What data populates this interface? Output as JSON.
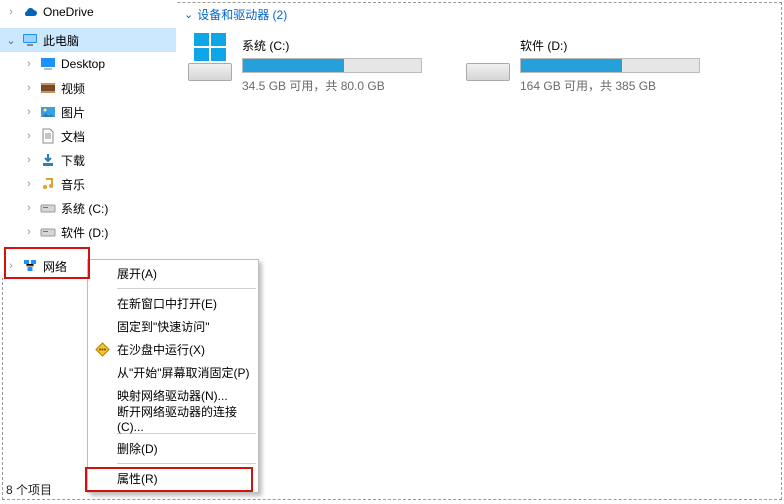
{
  "sidebar": {
    "onedrive_label": "OneDrive",
    "thispc_label": "此电脑",
    "items": [
      {
        "label": "Desktop"
      },
      {
        "label": "视频"
      },
      {
        "label": "图片"
      },
      {
        "label": "文档"
      },
      {
        "label": "下载"
      },
      {
        "label": "音乐"
      },
      {
        "label": "系统 (C:)"
      },
      {
        "label": "软件 (D:)"
      }
    ],
    "network_label": "网络"
  },
  "section": {
    "header": "设备和驱动器 (2)"
  },
  "drives": [
    {
      "name": "系统 (C:)",
      "subtitle": "34.5 GB 可用，共 80.0 GB",
      "fill_pct": 57
    },
    {
      "name": "软件 (D:)",
      "subtitle": "164 GB 可用，共 385 GB",
      "fill_pct": 57
    }
  ],
  "context_menu": {
    "items": [
      {
        "label": "展开(A)"
      },
      {
        "label": "在新窗口中打开(E)"
      },
      {
        "label": "固定到\"快速访问\""
      },
      {
        "label": "在沙盘中运行(X)",
        "icon": "sandbox"
      },
      {
        "label": "从\"开始\"屏幕取消固定(P)"
      },
      {
        "label": "映射网络驱动器(N)..."
      },
      {
        "label": "断开网络驱动器的连接(C)..."
      },
      {
        "label": "删除(D)"
      },
      {
        "label": "属性(R)"
      }
    ]
  },
  "status": {
    "text": "8 个项目"
  }
}
